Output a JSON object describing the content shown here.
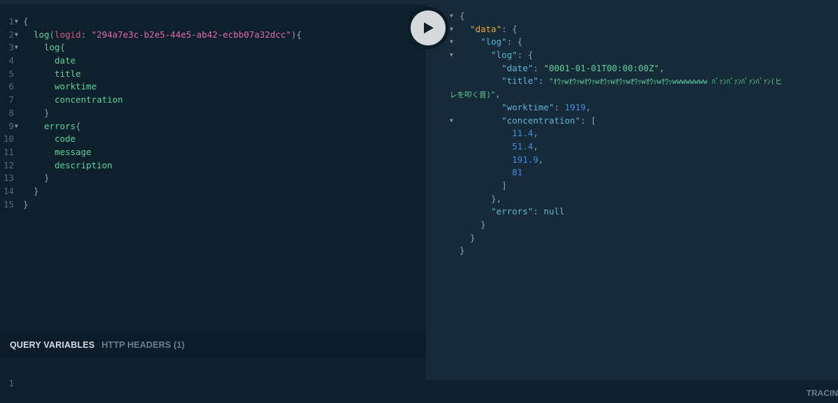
{
  "query_editor": {
    "logid": "294a7e3c-b2e5-44e5-ab42-ecbb07a32dcc",
    "fields": {
      "log": "log",
      "logid_arg": "logid",
      "log_inner": "log",
      "date": "date",
      "title": "title",
      "worktime": "worktime",
      "concentration": "concentration",
      "errors": "errors",
      "code": "code",
      "message": "message",
      "description": "description"
    },
    "line_numbers": [
      "1",
      "2",
      "3",
      "4",
      "5",
      "6",
      "7",
      "8",
      "9",
      "10",
      "11",
      "12",
      "13",
      "14",
      "15"
    ]
  },
  "variables_panel": {
    "tabs": [
      "QUERY VARIABLES",
      "HTTP HEADERS (1)"
    ],
    "line_number": "1"
  },
  "footer": {
    "tracing_label": "TRACIN"
  },
  "result": {
    "keys": {
      "data": "\"data\"",
      "log_outer": "\"log\"",
      "log_inner": "\"log\"",
      "date": "\"date\"",
      "title": "\"title\"",
      "worktime": "\"worktime\"",
      "concentration": "\"concentration\"",
      "errors": "\"errors\""
    },
    "date": "\"0001-01-01T00:00:00Z\"",
    "title_line1": "\"ｵｳｯwｵｳｯwｵｳｯwｵｳｯwｵｳｯwｵｳｯwｵｳｯwｵｳｯwwwwwwww ﾊﾞｧﾝﾊﾞｧﾝﾊﾞｧﾝﾊﾞｧﾝ(ヒ",
    "title_line2": "レを叩く音)\"",
    "worktime": "1919",
    "concentration": [
      "11.4",
      "51.4",
      "191.9",
      "81"
    ],
    "errors": "null"
  },
  "colors": {
    "background": "#0f202d",
    "result_background": "#172a3a",
    "field": "#5dd29a",
    "argument": "#d45a83",
    "string_arg": "#e56aa5",
    "json_key": "#5db5d6",
    "data_key": "#e4a443",
    "number": "#3e8fe0"
  },
  "icons": {
    "run": "play-icon",
    "fold": "triangle-down-icon"
  }
}
